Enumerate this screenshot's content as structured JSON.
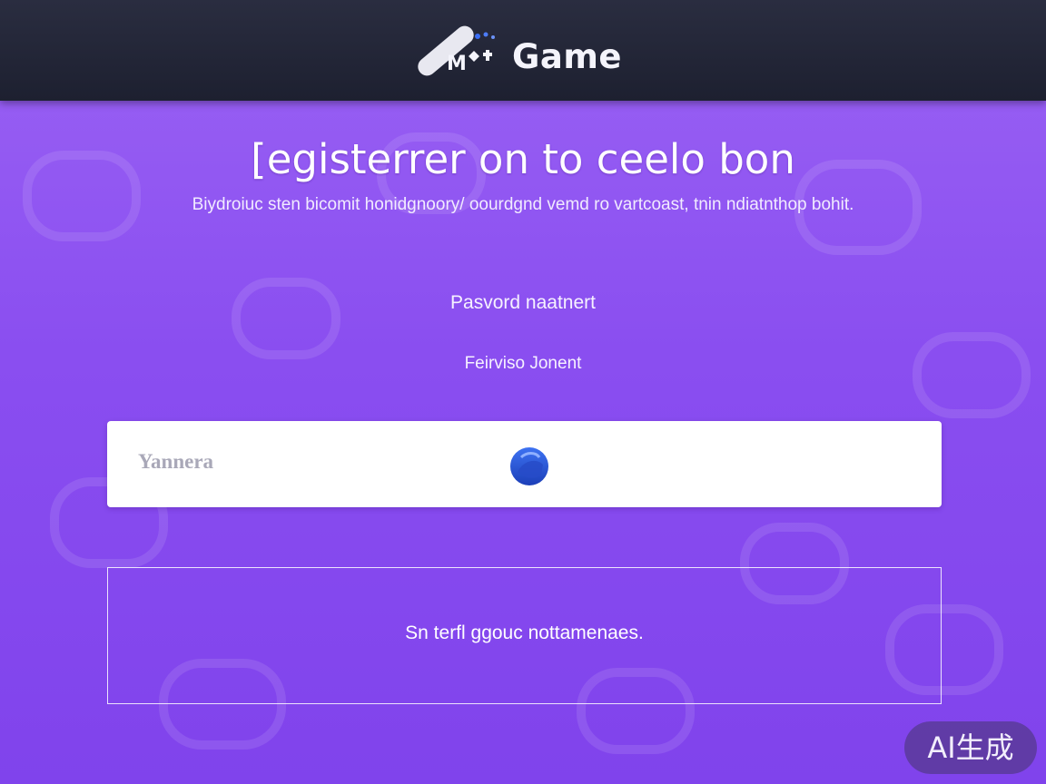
{
  "header": {
    "logo_icon": "pen-icon",
    "logo_text": "Game"
  },
  "main": {
    "title": "[egisterrer on to ceelo bon",
    "subtitle": "Biydroiuc sten bicomit honidgnoory/ oourdgnd vemd ro vartcoast, tnin ndiatnthop bohit.",
    "password_label": "Pasvord naatnert",
    "revision_label": "Feirviso Jonent",
    "username_field": {
      "placeholder": "Yannera",
      "badge_icon": "shield-icon"
    },
    "notice_text": "Sn terfl ggouc nottamenaes."
  },
  "watermark": {
    "text": "AI生成"
  },
  "colors": {
    "header_bg": "#23263a",
    "page_bg": "#8a4ef0",
    "field_bg": "#ffffff",
    "badge_blue": "#2f5de0"
  }
}
